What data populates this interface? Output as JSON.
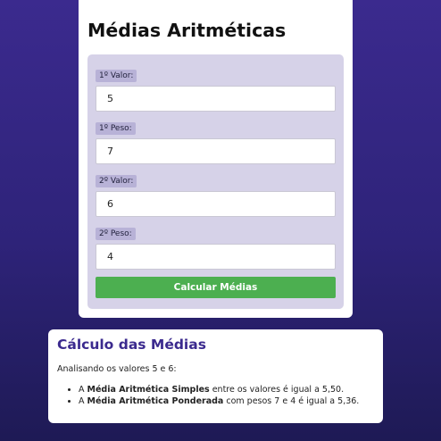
{
  "colors": {
    "background_top": "#3b2a8e",
    "background_bottom": "#1e1a55",
    "panel": "#d6d2e8",
    "label_badge": "#b8b2d7",
    "button": "#4caf50",
    "results_title": "#3b2a8e"
  },
  "form": {
    "title": "Médias Aritméticas",
    "fields": [
      {
        "label": "1º Valor:",
        "value": "5"
      },
      {
        "label": "1º Peso:",
        "value": "7"
      },
      {
        "label": "2º Valor:",
        "value": "6"
      },
      {
        "label": "2º Peso:",
        "value": "4"
      }
    ],
    "submit_label": "Calcular Médias"
  },
  "results": {
    "title": "Cálculo das Médias",
    "intro": "Analisando os valores 5 e 6:",
    "items": [
      {
        "prefix": "A ",
        "bold": "Média Aritmética Simples",
        "suffix": " entre os valores é igual a 5,50."
      },
      {
        "prefix": "A ",
        "bold": "Média Aritmética Ponderada",
        "suffix": " com pesos 7 e 4 é igual a 5,36."
      }
    ]
  }
}
